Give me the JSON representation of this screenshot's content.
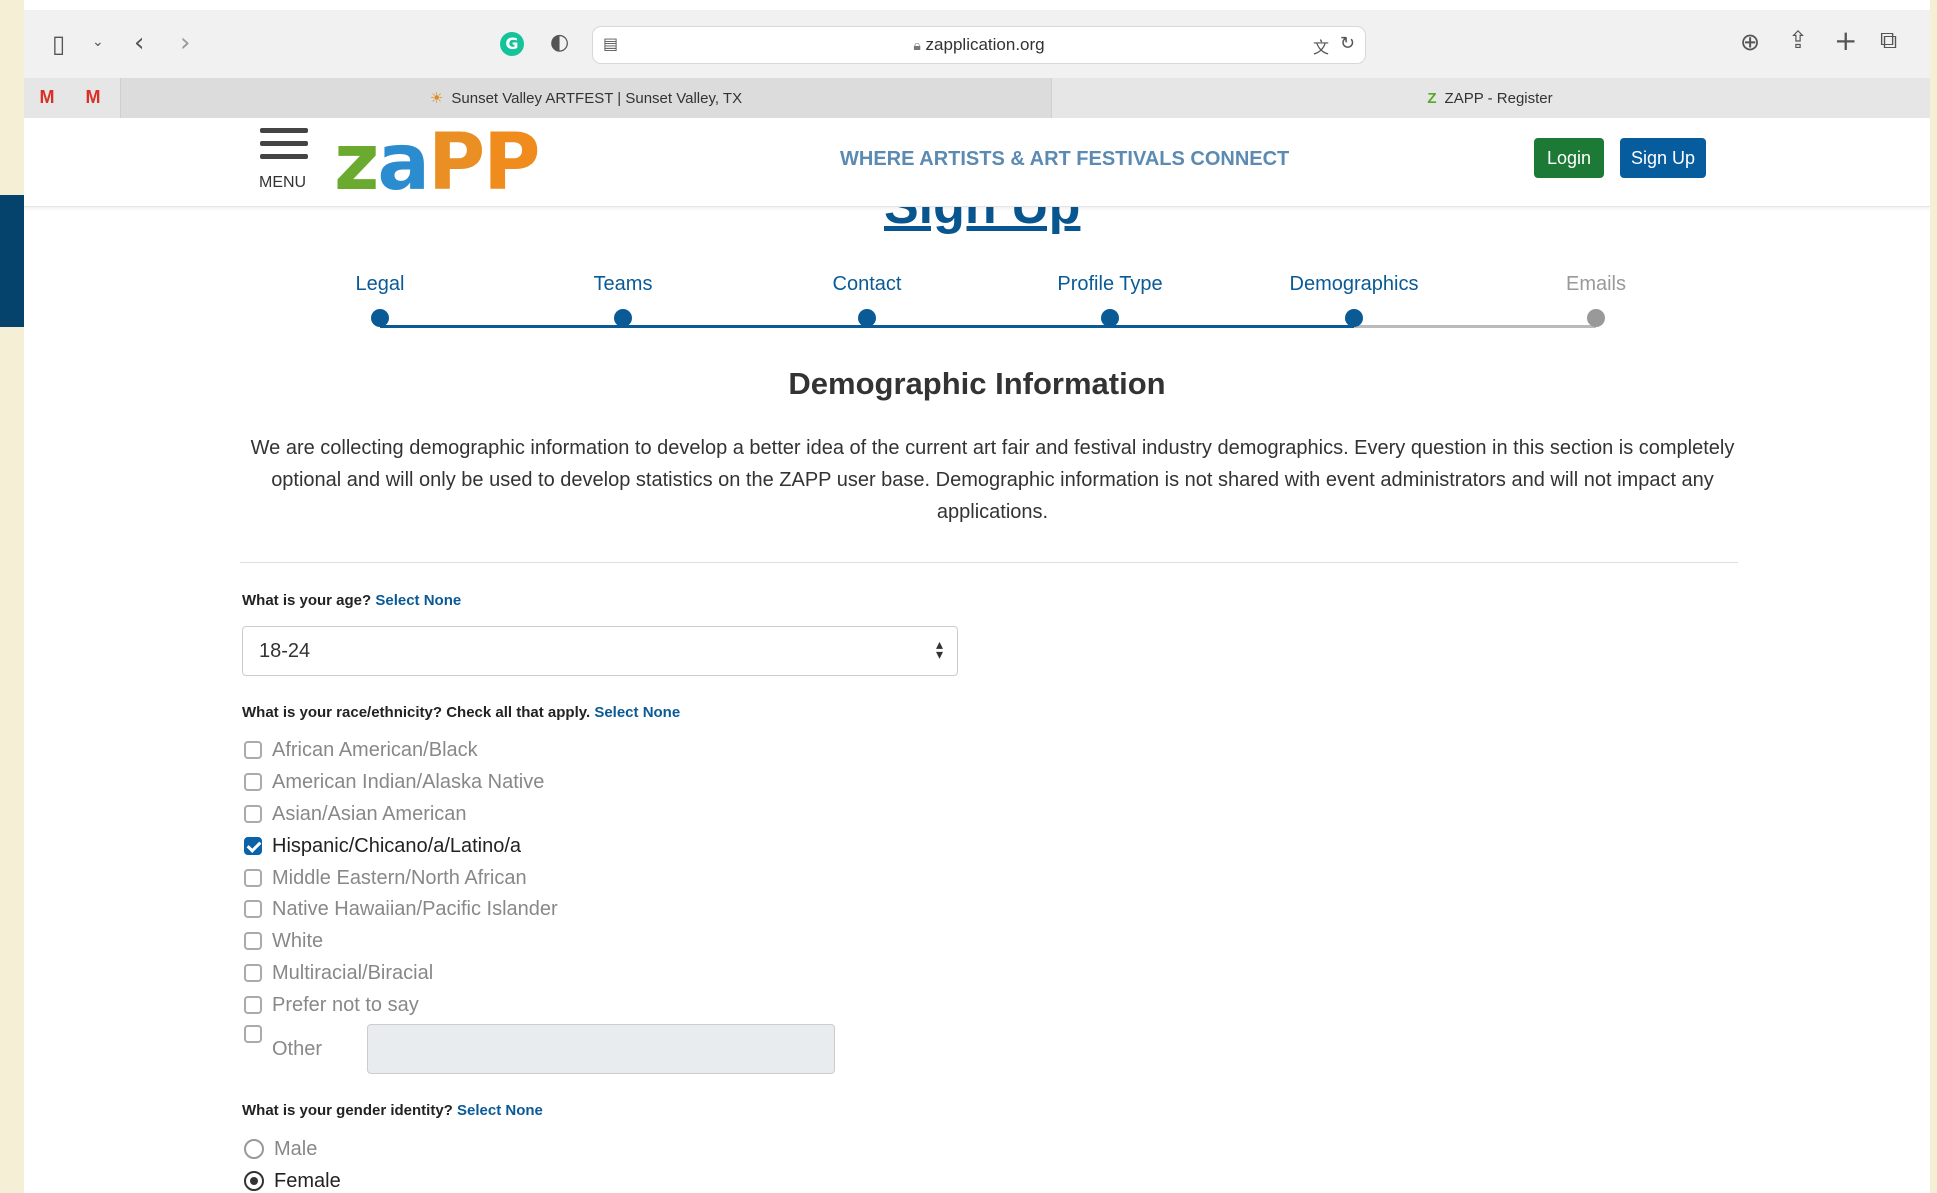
{
  "browser": {
    "url": "zapplication.org",
    "tabs": [
      {
        "label": "Sunset Valley ARTFEST | Sunset Valley, TX",
        "active": true
      },
      {
        "label": "ZAPP - Register",
        "active": false
      }
    ],
    "pinned": [
      "M",
      "M"
    ]
  },
  "header": {
    "menu_label": "MENU",
    "logo": "zapp",
    "tagline": "WHERE ARTISTS & ART FESTIVALS CONNECT",
    "login_label": "Login",
    "signup_label": "Sign Up"
  },
  "page": {
    "title": "Sign Up",
    "steps": [
      {
        "label": "Legal",
        "state": "done"
      },
      {
        "label": "Teams",
        "state": "done"
      },
      {
        "label": "Contact",
        "state": "done"
      },
      {
        "label": "Profile Type",
        "state": "done"
      },
      {
        "label": "Demographics",
        "state": "current"
      },
      {
        "label": "Emails",
        "state": "pending"
      }
    ],
    "section_title": "Demographic Information",
    "intro": "We are collecting demographic information to develop a better idea of the current art fair and festival industry demographics. Every question in this section is completely optional and will only be used to develop statistics on the ZAPP user base. Demographic information is not shared with event administrators and will not impact any applications."
  },
  "age": {
    "question": "What is your age?",
    "select_none": "Select None",
    "value": "18-24"
  },
  "race": {
    "question": "What is your race/ethnicity? Check all that apply.",
    "select_none": "Select None",
    "options": [
      {
        "label": "African American/Black",
        "checked": false
      },
      {
        "label": "American Indian/Alaska Native",
        "checked": false
      },
      {
        "label": "Asian/Asian American",
        "checked": false
      },
      {
        "label": "Hispanic/Chicano/a/Latino/a",
        "checked": true
      },
      {
        "label": "Middle Eastern/North African",
        "checked": false
      },
      {
        "label": "Native Hawaiian/Pacific Islander",
        "checked": false
      },
      {
        "label": "White",
        "checked": false
      },
      {
        "label": "Multiracial/Biracial",
        "checked": false
      },
      {
        "label": "Prefer not to say",
        "checked": false
      },
      {
        "label": "Other",
        "checked": false
      }
    ]
  },
  "gender": {
    "question": "What is your gender identity?",
    "select_none": "Select None",
    "options": [
      {
        "label": "Male",
        "selected": false
      },
      {
        "label": "Female",
        "selected": true
      }
    ]
  },
  "colors": {
    "brand_blue": "#0a5a96",
    "login_green": "#1d7a36",
    "signup_blue": "#075c9e"
  }
}
